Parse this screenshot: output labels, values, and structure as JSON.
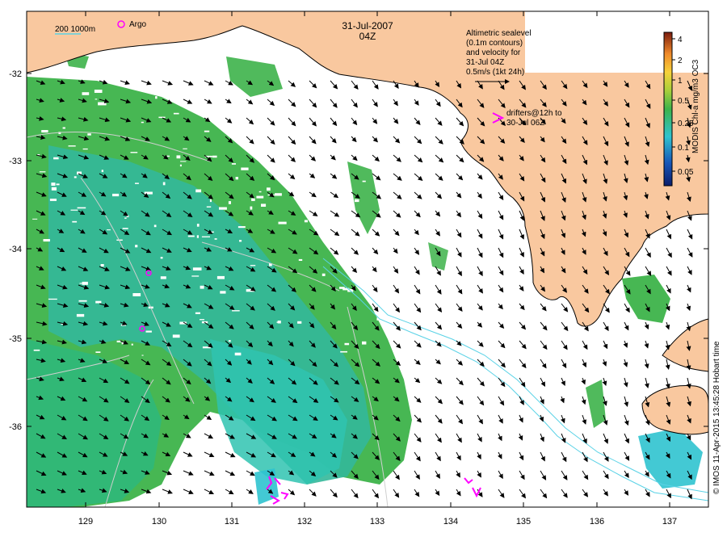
{
  "map": {
    "date": "31-Jul-2007",
    "time": "04Z",
    "bathymetry_legend": "200  1000m",
    "argo_label": "Argo",
    "velocity_note": [
      "Altimetric sealevel",
      "(0.1m contours)",
      "and velocity for",
      "31-Jul 04Z",
      "0.5m/s (1kt 24h)"
    ],
    "drifter_note": [
      "drifters@12h to",
      "30-Jul 06Z"
    ],
    "credit": "© IMOS 11-Apr-2015 13:45:28 Hobart time"
  },
  "axes": {
    "x_ticks": [
      "129",
      "130",
      "131",
      "132",
      "133",
      "134",
      "135",
      "136",
      "137"
    ],
    "y_ticks": [
      "-32",
      "-33",
      "-34",
      "-35",
      "-36"
    ]
  },
  "colorbar": {
    "title": "MODIS Chl-a mg/m3 OC3",
    "ticks": [
      "4",
      "2",
      "1",
      "0.5",
      "0.25",
      "0.1",
      "0.05"
    ]
  },
  "colors": {
    "land": "#f9c89f",
    "chl_high": "#3db34a",
    "chl_mid": "#33b89a",
    "chl_low": "#2fc3cf",
    "bathymetry": "#5ad2e6",
    "drifter": "#ff00ff"
  }
}
